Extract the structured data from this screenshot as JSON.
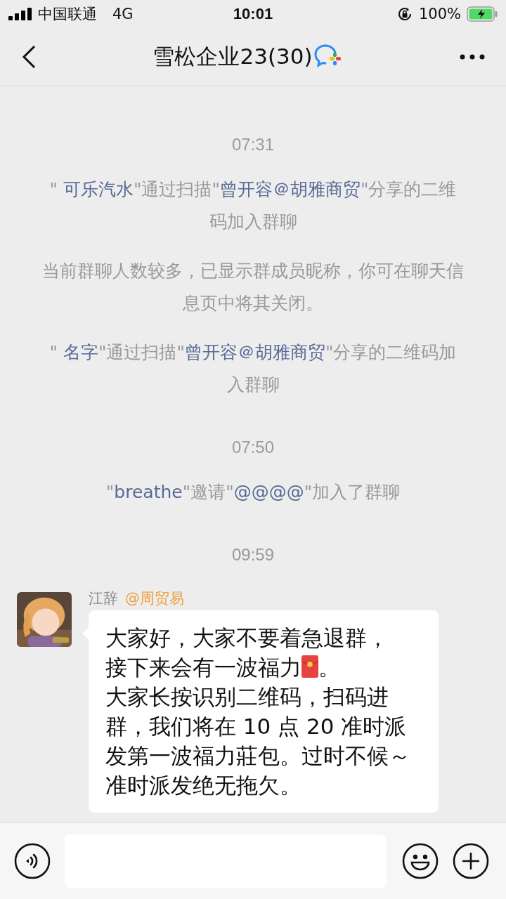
{
  "status_bar": {
    "carrier": "中国联通",
    "network": "4G",
    "time": "10:01",
    "battery": "100%"
  },
  "header": {
    "title": "雪松企业23(30)"
  },
  "messages": [
    {
      "kind": "time",
      "text": "07:31"
    },
    {
      "kind": "system",
      "parts": [
        {
          "kind": "plain",
          "text": "\" "
        },
        {
          "kind": "name",
          "text": "可乐汽水"
        },
        {
          "kind": "plain",
          "text": "\"通过扫描\""
        },
        {
          "kind": "name",
          "text": "曾开容＠胡雅商贸"
        },
        {
          "kind": "plain",
          "text": "\"分享的二维码加入群聊"
        }
      ]
    },
    {
      "kind": "system",
      "parts": [
        {
          "kind": "plain",
          "text": "当前群聊人数较多，已显示群成员昵称，你可在聊天信息页中将其关闭。"
        }
      ]
    },
    {
      "kind": "system",
      "parts": [
        {
          "kind": "plain",
          "text": "\" "
        },
        {
          "kind": "name",
          "text": "名字"
        },
        {
          "kind": "plain",
          "text": "\"通过扫描\""
        },
        {
          "kind": "name",
          "text": "曾开容＠胡雅商贸"
        },
        {
          "kind": "plain",
          "text": "\"分享的二维码加入群聊"
        }
      ]
    },
    {
      "kind": "time",
      "text": "07:50"
    },
    {
      "kind": "system",
      "parts": [
        {
          "kind": "plain",
          "text": "\""
        },
        {
          "kind": "name",
          "text": "breathe"
        },
        {
          "kind": "plain",
          "text": "\"邀请\""
        },
        {
          "kind": "name",
          "text": "@@@@"
        },
        {
          "kind": "plain",
          "text": "\"加入了群聊"
        }
      ]
    },
    {
      "kind": "time",
      "text": "09:59"
    },
    {
      "kind": "chat",
      "sender": "江辞",
      "sender_org": "@周贸易",
      "lines": [
        {
          "parts": [
            {
              "kind": "text",
              "text": "大家好，大家不要着急退群，"
            }
          ]
        },
        {
          "parts": [
            {
              "kind": "text",
              "text": "接下来会有一波福力"
            },
            {
              "kind": "red_packet"
            },
            {
              "kind": "text",
              "text": "。"
            }
          ]
        },
        {
          "parts": [
            {
              "kind": "text",
              "text": "大家长按识别二维码，扫码进群，我们将在 10 点 20 准时派发第一波福力莊包。过时不候～准时派发绝无拖欠。"
            }
          ]
        }
      ]
    }
  ]
}
